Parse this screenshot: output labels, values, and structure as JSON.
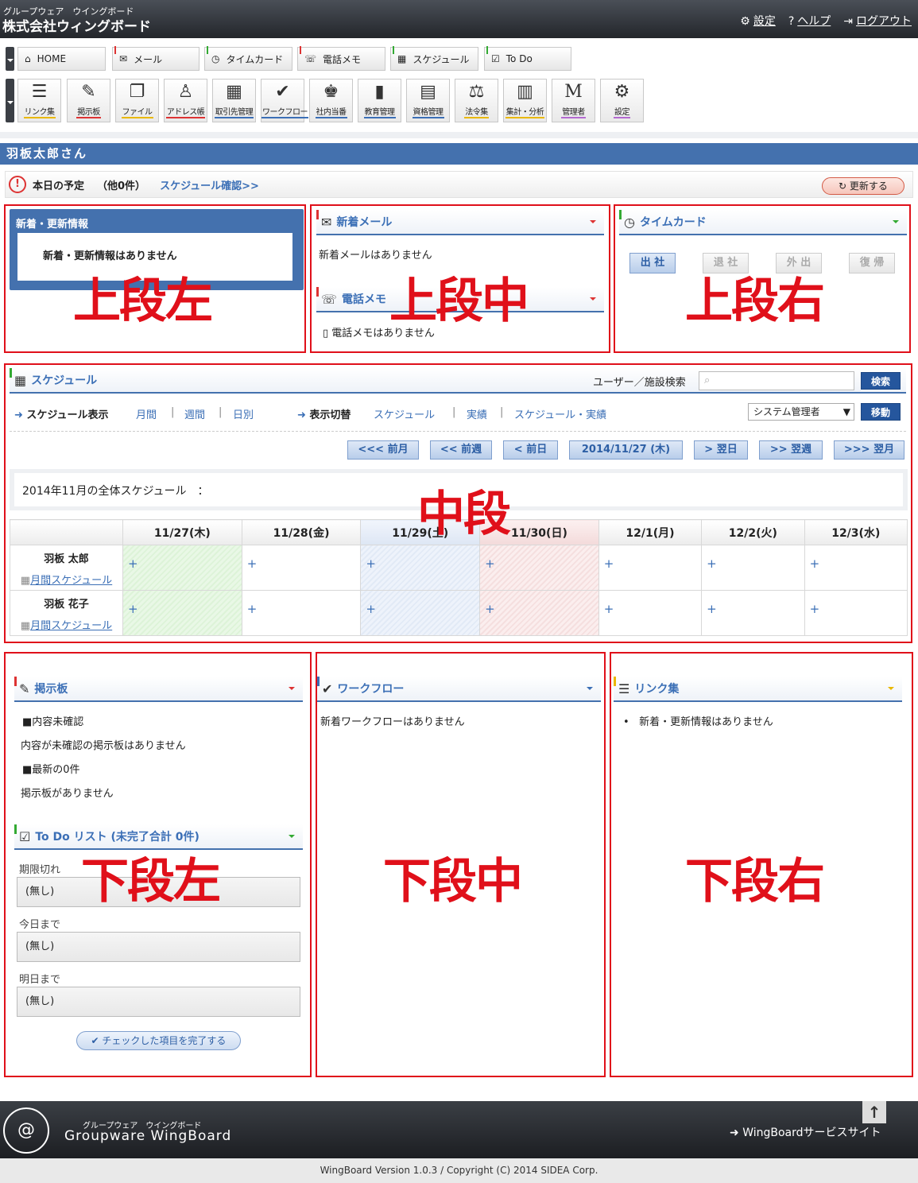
{
  "header": {
    "sub": "グループウェア　ウイングボード",
    "company": "株式会社ウィングボード",
    "links": [
      "設定",
      "ヘルプ",
      "ログアウト"
    ]
  },
  "nav1": [
    "HOME",
    "メール",
    "タイムカード",
    "電話メモ",
    "スケジュール",
    "To Do"
  ],
  "nav2": [
    "リンク集",
    "掲示板",
    "ファイル",
    "アドレス帳",
    "取引先管理",
    "ワークフロー",
    "社内当番",
    "教育管理",
    "資格管理",
    "法令集",
    "集計・分析",
    "管理者",
    "設定"
  ],
  "user": "羽板太郎さん",
  "today": {
    "label": "本日の予定",
    "other": "（他0件）",
    "link": "スケジュール確認>>",
    "refresh": "更新する"
  },
  "zones": [
    "上段左",
    "上段中",
    "上段右",
    "中段",
    "下段左",
    "下段中",
    "下段右"
  ],
  "news": {
    "title": "新着・更新情報",
    "empty": "新着・更新情報はありません"
  },
  "mail": {
    "title": "新着メール",
    "empty": "新着メールはありません"
  },
  "memo": {
    "title": "電話メモ",
    "empty": "電話メモはありません"
  },
  "timecard": {
    "title": "タイムカード",
    "buttons": [
      "出 社",
      "退 社",
      "外 出",
      "復 帰"
    ]
  },
  "schedule": {
    "title": "スケジュール",
    "search_label": "ユーザー／施設検索",
    "search_btn": "検索",
    "view_label": "スケジュール表示",
    "views": [
      "月間",
      "週間",
      "日別"
    ],
    "switch_label": "表示切替",
    "switches": [
      "スケジュール",
      "実績",
      "スケジュール・実績"
    ],
    "select": "システム管理者",
    "move": "移動",
    "navs": [
      "<<< 前月",
      "<< 前週",
      "< 前日",
      "2014/11/27 (木)",
      "> 翌日",
      ">> 翌週",
      ">>> 翌月"
    ],
    "overall": "2014年11月の全体スケジュール　：",
    "days": [
      "11/27(木)",
      "11/28(金)",
      "11/29(土)",
      "11/30(日)",
      "12/1(月)",
      "12/2(火)",
      "12/3(水)"
    ],
    "rows": [
      {
        "name": "羽板 太郎",
        "link": "月間スケジュール"
      },
      {
        "name": "羽板 花子",
        "link": "月間スケジュール"
      }
    ],
    "plus": "+"
  },
  "board": {
    "title": "掲示板",
    "lines": [
      "■内容未確認",
      "内容が未確認の掲示板はありません",
      "■最新の0件",
      "掲示板がありません"
    ]
  },
  "todo": {
    "title": "To Do リスト (未完了合計 0件)",
    "groups": [
      {
        "label": "期限切れ",
        "value": "(無し)"
      },
      {
        "label": "今日まで",
        "value": "(無し)"
      },
      {
        "label": "明日まで",
        "value": "(無し)"
      }
    ],
    "complete": "チェックした項目を完了する"
  },
  "workflow": {
    "title": "ワークフロー",
    "empty": "新着ワークフローはありません"
  },
  "links": {
    "title": "リンク集",
    "empty": "新着・更新情報はありません"
  },
  "footer": {
    "sub": "グループウェア　ウイングボード",
    "brand": "Groupware WingBoard",
    "site": "WingBoardサービスサイト",
    "copyright": "WingBoard Version 1.0.3 / Copyright (C) 2014 SIDEA Corp."
  }
}
